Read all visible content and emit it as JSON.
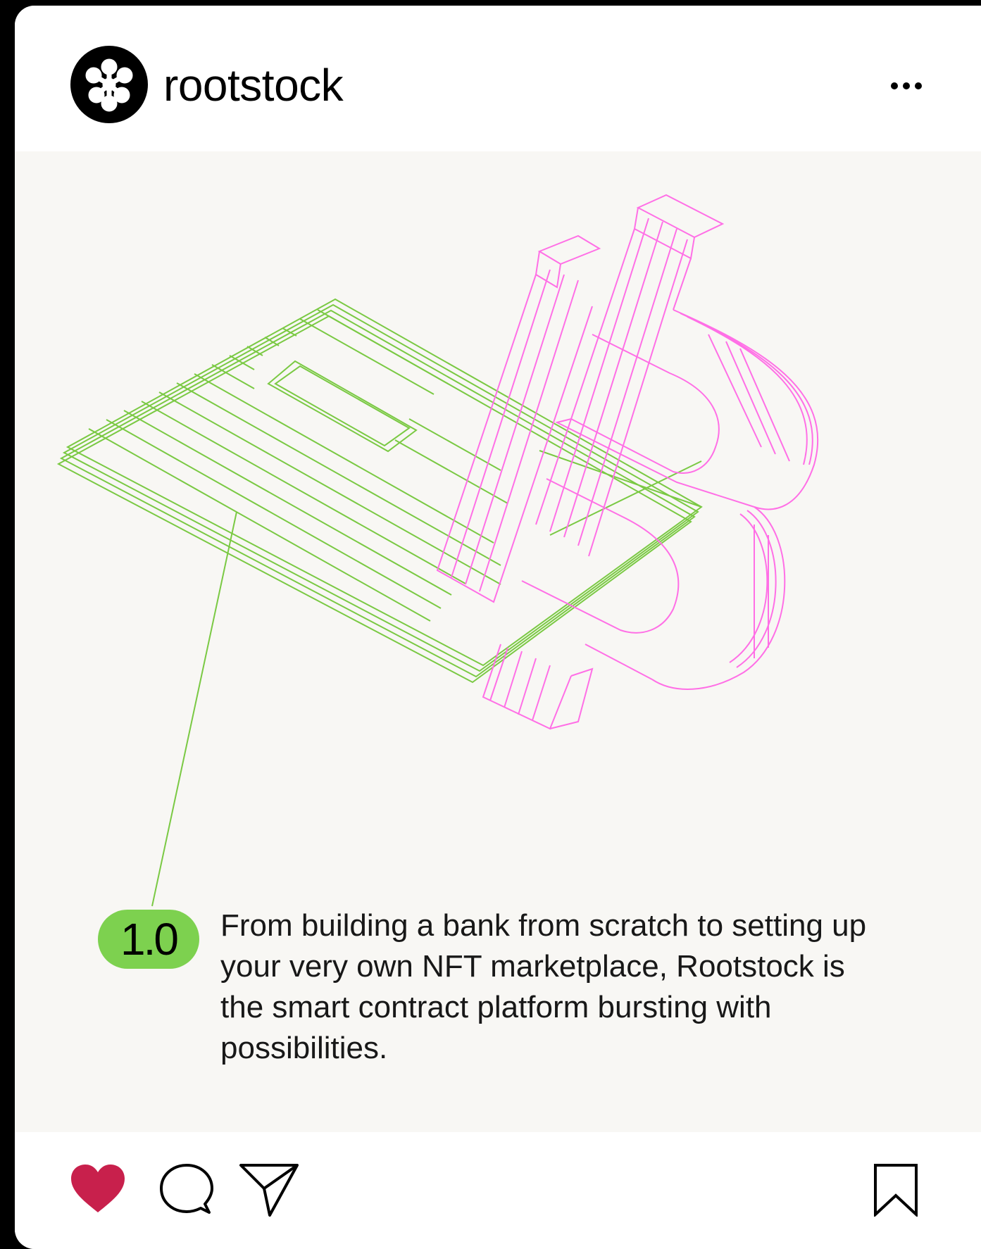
{
  "post": {
    "username": "rootstock",
    "avatar_icon": "rootstock-logo-icon",
    "more_icon": "more-dots-icon",
    "badge": "1.0",
    "caption": "From building a bank from scratch to setting up your very own NFT marketplace, Rootstock is the smart contract platform bursting with possibilities.",
    "illustration": "bitcoin-on-card-illustration"
  },
  "actions": {
    "like_icon": "heart-icon",
    "comment_icon": "comment-icon",
    "share_icon": "send-icon",
    "save_icon": "bookmark-icon",
    "liked": true
  },
  "colors": {
    "heart": "#c8204c",
    "badge": "#7dd14f",
    "card_lines": "#7ac943",
    "bitcoin_lines": "#ff6fe6",
    "post_background": "#f8f7f4"
  }
}
